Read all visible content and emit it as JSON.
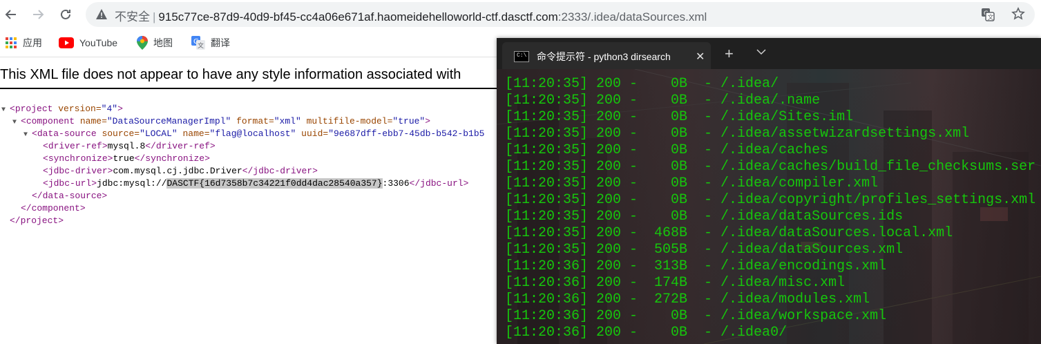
{
  "browser": {
    "address_bar": {
      "insecure_label": "不安全",
      "separator": "|",
      "host": "915c77ce-87d9-40d9-bf45-cc4a06e671af.haomeidehelloworld-ctf.dasctf.com",
      "port_path": ":2333/.idea/dataSources.xml"
    },
    "bookmarks": [
      {
        "label": "应用",
        "icon": "apps-grid-icon"
      },
      {
        "label": "YouTube",
        "icon": "youtube-icon"
      },
      {
        "label": "地图",
        "icon": "maps-pin-icon"
      },
      {
        "label": "翻译",
        "icon": "translate-icon"
      }
    ]
  },
  "xml_viewer": {
    "header": "This XML file does not appear to have any style information associated with",
    "lines": {
      "project_open": {
        "tag": "project",
        "attr1": "version",
        "val1": "\"4\""
      },
      "component_open": {
        "tag": "component",
        "attr1": "name",
        "val1": "\"DataSourceManagerImpl\"",
        "attr2": "format",
        "val2": "\"xml\"",
        "attr3": "multifile-model",
        "val3": "\"true\""
      },
      "datasource_open": {
        "tag": "data-source",
        "attr1": "source",
        "val1": "\"LOCAL\"",
        "attr2": "name",
        "val2": "\"flag@localhost\"",
        "attr3": "uuid",
        "val3": "\"9e687dff-ebb7-45db-b542-b1b5"
      },
      "driver_ref": {
        "tag": "driver-ref",
        "text": "mysql.8"
      },
      "synchronize": {
        "tag": "synchronize",
        "text": "true"
      },
      "jdbc_driver": {
        "tag": "jdbc-driver",
        "text": "com.mysql.cj.jdbc.Driver"
      },
      "jdbc_url": {
        "tag": "jdbc-url",
        "text_prefix": "jdbc:mysql://",
        "flag": "DASCTF{16d7358b7c34221f0dd4dac28540a357}",
        "text_suffix": ":3306"
      },
      "datasource_close": "</data-source>",
      "component_close": "</component>",
      "project_close": "</project>"
    }
  },
  "terminal": {
    "tab_title": "命令提示符 - python3  dirsearch",
    "tab_icon_text": "C:\\",
    "new_tab": "+",
    "lines": [
      "[11:20:35] 200 -    0B  - /.idea/",
      "[11:20:35] 200 -    0B  - /.idea/.name",
      "[11:20:35] 200 -    0B  - /.idea/Sites.iml",
      "[11:20:35] 200 -    0B  - /.idea/assetwizardsettings.xml",
      "[11:20:35] 200 -    0B  - /.idea/caches",
      "[11:20:35] 200 -    0B  - /.idea/caches/build_file_checksums.ser",
      "[11:20:35] 200 -    0B  - /.idea/compiler.xml",
      "[11:20:35] 200 -    0B  - /.idea/copyright/profiles_settings.xml",
      "[11:20:35] 200 -    0B  - /.idea/dataSources.ids",
      "[11:20:35] 200 -  468B  - /.idea/dataSources.local.xml",
      "[11:20:35] 200 -  505B  - /.idea/dataSources.xml",
      "[11:20:36] 200 -  313B  - /.idea/encodings.xml",
      "[11:20:36] 200 -  174B  - /.idea/misc.xml",
      "[11:20:36] 200 -  272B  - /.idea/modules.xml",
      "[11:20:36] 200 -    0B  - /.idea/workspace.xml",
      "[11:20:36] 200 -    0B  - /.idea0/"
    ],
    "text_color": "#16c60c"
  }
}
